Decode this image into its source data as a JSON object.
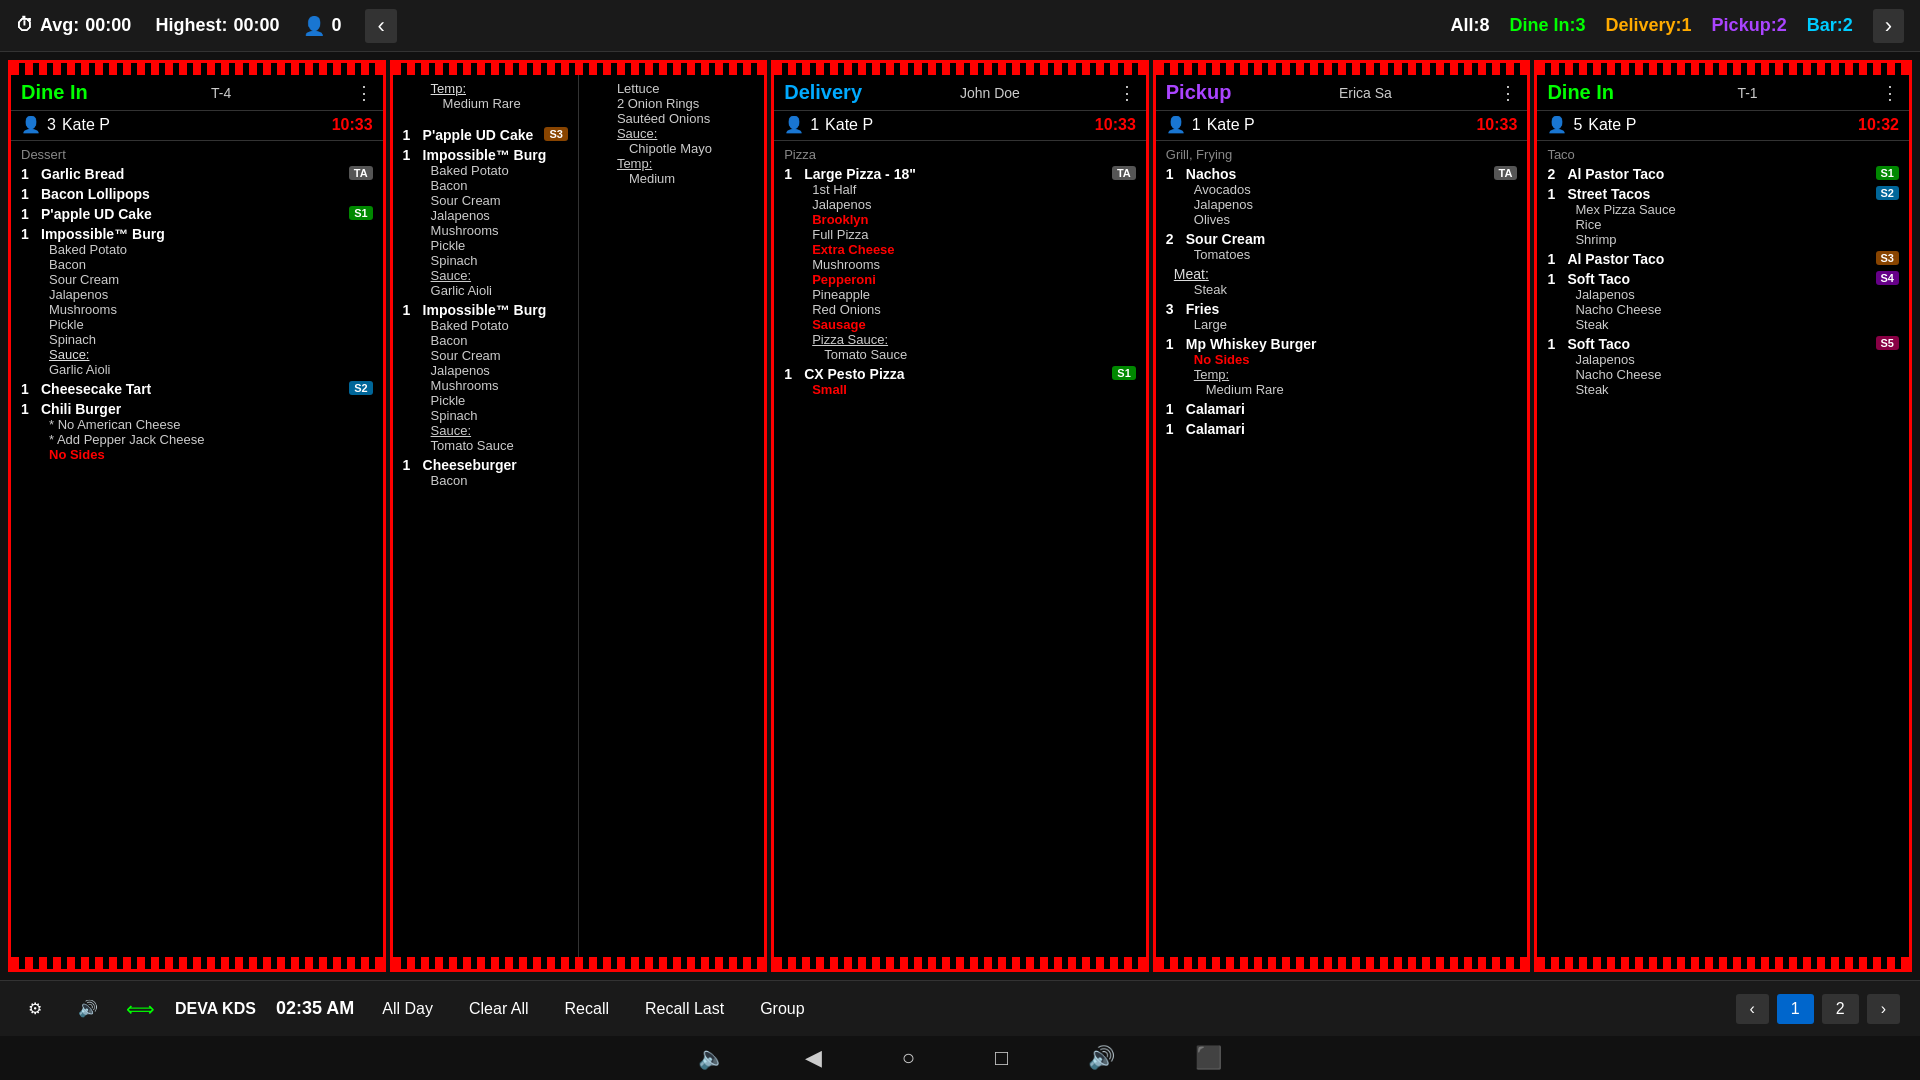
{
  "topBar": {
    "avg_label": "Avg:",
    "avg_value": "00:00",
    "highest_label": "Highest:",
    "highest_value": "00:00",
    "guests": "0",
    "counts": {
      "all_label": "All:",
      "all_value": "8",
      "dinein_label": "Dine In:",
      "dinein_value": "3",
      "delivery_label": "Delivery:",
      "delivery_value": "1",
      "pickup_label": "Pickup:",
      "pickup_value": "2",
      "bar_label": "Bar:",
      "bar_value": "2"
    }
  },
  "cards": [
    {
      "type": "Dine In",
      "typeClass": "dinein",
      "tableNum": "T-4",
      "customer": "Kate P",
      "guests": "3",
      "time": "10:33",
      "sectionLabel": "Dessert",
      "items": [
        {
          "qty": "1",
          "name": "Garlic Bread",
          "badge": "TA",
          "badgeClass": "ta",
          "modifiers": []
        },
        {
          "qty": "1",
          "name": "Bacon Lollipops",
          "badge": "",
          "badgeClass": "",
          "modifiers": []
        },
        {
          "qty": "1",
          "name": "P'apple UD Cake",
          "badge": "S1",
          "badgeClass": "s1",
          "modifiers": []
        },
        {
          "qty": "1",
          "name": "Impossible™ Burg",
          "badge": "",
          "badgeClass": "",
          "modifiers": [
            {
              "text": "Baked Potato",
              "style": ""
            },
            {
              "text": "Bacon",
              "style": ""
            },
            {
              "text": "Sour Cream",
              "style": ""
            },
            {
              "text": "Jalapenos",
              "style": ""
            },
            {
              "text": "Mushrooms",
              "style": ""
            },
            {
              "text": "Pickle",
              "style": ""
            },
            {
              "text": "Spinach",
              "style": ""
            },
            {
              "text": "Sauce:",
              "style": "underline"
            },
            {
              "text": "Garlic Aioli",
              "style": ""
            }
          ]
        },
        {
          "qty": "1",
          "name": "Cheesecake Tart",
          "badge": "S2",
          "badgeClass": "s2",
          "modifiers": []
        },
        {
          "qty": "1",
          "name": "Chili Burger",
          "badge": "",
          "badgeClass": "",
          "modifiers": [
            {
              "text": "* No American Cheese",
              "style": ""
            },
            {
              "text": "* Add Pepper Jack Cheese",
              "style": ""
            },
            {
              "text": "No Sides",
              "style": "red"
            }
          ]
        }
      ]
    },
    {
      "type": "continuation",
      "items_top": [
        {
          "text": "Temp:",
          "style": "underline"
        },
        {
          "text": "Medium Rare",
          "style": "indent"
        },
        {
          "text": "",
          "style": ""
        },
        {
          "qty": "1",
          "name": "P'apple UD Cake",
          "badge": "S3",
          "badgeClass": "s3"
        },
        {
          "qty": "1",
          "name": "Impossible™ Burg",
          "badge": "",
          "badgeClass": "",
          "modifiers": [
            "Baked Potato",
            "Bacon",
            "Sour Cream",
            "Jalapenos",
            "Mushrooms",
            "Pickle",
            "Spinach",
            "Sauce:",
            "Garlic Aioli"
          ]
        },
        {
          "qty": "1",
          "name": "Impossible™ Burg",
          "badge": "",
          "badgeClass": "",
          "modifiers": [
            "Baked Potato",
            "Bacon",
            "Sour Cream",
            "Jalapenos",
            "Mushrooms",
            "Pickle",
            "Spinach",
            "Sauce:",
            "Tomato Sauce"
          ]
        },
        {
          "qty": "1",
          "name": "Cheeseburger",
          "badge": "",
          "badgeClass": "",
          "modifiers": [
            "Bacon"
          ]
        }
      ],
      "items_right": [
        "Lettuce",
        "2 Onion Rings",
        "Sautéed Onions",
        "Sauce:",
        "Chipotle Mayo",
        "Temp:",
        "Medium"
      ]
    },
    {
      "type": "Delivery",
      "typeClass": "delivery",
      "customerName": "John Doe",
      "customer": "Kate P",
      "guests": "1",
      "time": "10:33",
      "sectionLabel": "Pizza",
      "items": [
        {
          "qty": "1",
          "name": "Large Pizza - 18\"",
          "badge": "TA",
          "badgeClass": "ta",
          "modifiers": [
            {
              "text": "1st Half",
              "style": ""
            },
            {
              "text": "Jalapenos",
              "style": ""
            },
            {
              "text": "Brooklyn",
              "style": "red"
            },
            {
              "text": "Full Pizza",
              "style": ""
            },
            {
              "text": "Extra Cheese",
              "style": "red"
            },
            {
              "text": "Mushrooms",
              "style": ""
            },
            {
              "text": "Pepperoni",
              "style": "red"
            },
            {
              "text": "Pineapple",
              "style": ""
            },
            {
              "text": "Red Onions",
              "style": ""
            },
            {
              "text": "Sausage",
              "style": "red"
            },
            {
              "text": "Pizza Sauce:",
              "style": "underline"
            },
            {
              "text": "Tomato Sauce",
              "style": ""
            }
          ]
        },
        {
          "qty": "1",
          "name": "CX Pesto Pizza",
          "badge": "S1",
          "badgeClass": "s1",
          "modifiers": [
            {
              "text": "Small",
              "style": "red"
            }
          ]
        }
      ]
    },
    {
      "type": "Pickup",
      "typeClass": "pickup",
      "customerName": "Erica Sa",
      "customer": "Kate P",
      "guests": "1",
      "time": "10:33",
      "sectionLabel": "Grill, Frying",
      "items": [
        {
          "qty": "1",
          "name": "Nachos",
          "badge": "TA",
          "badgeClass": "ta",
          "modifiers": [
            {
              "text": "Avocados",
              "style": ""
            },
            {
              "text": "Jalapenos",
              "style": ""
            },
            {
              "text": "Olives",
              "style": ""
            }
          ]
        },
        {
          "qty": "2",
          "name": "Sour Cream",
          "badge": "",
          "badgeClass": "",
          "modifiers": [
            {
              "text": "Tomatoes",
              "style": ""
            }
          ]
        },
        {
          "qty": "",
          "name": "Meat:",
          "badge": "",
          "badgeClass": "",
          "isLabel": true,
          "modifiers": [
            {
              "text": "Steak",
              "style": ""
            }
          ]
        },
        {
          "qty": "3",
          "name": "Fries",
          "badge": "",
          "badgeClass": "",
          "modifiers": [
            {
              "text": "Large",
              "style": ""
            }
          ]
        },
        {
          "qty": "1",
          "name": "Mp Whiskey Burger",
          "badge": "",
          "badgeClass": "",
          "modifiers": [
            {
              "text": "No Sides",
              "style": "red"
            },
            {
              "text": "Temp:",
              "style": "underline"
            },
            {
              "text": "Medium Rare",
              "style": ""
            }
          ]
        },
        {
          "qty": "1",
          "name": "Calamari",
          "badge": "",
          "badgeClass": "",
          "modifiers": []
        },
        {
          "qty": "1",
          "name": "Calamari",
          "badge": "",
          "badgeClass": "",
          "modifiers": []
        }
      ]
    },
    {
      "type": "Dine In",
      "typeClass": "dinein",
      "tableNum": "T-1",
      "customer": "Kate P",
      "guests": "5",
      "time": "10:32",
      "sectionLabel": "Taco",
      "items": [
        {
          "qty": "2",
          "name": "Al Pastor Taco",
          "badge": "S1",
          "badgeClass": "s1",
          "modifiers": []
        },
        {
          "qty": "1",
          "name": "Street Tacos",
          "badge": "S2",
          "badgeClass": "s2",
          "modifiers": [
            {
              "text": "Mex Pizza Sauce",
              "style": ""
            },
            {
              "text": "Rice",
              "style": ""
            },
            {
              "text": "Shrimp",
              "style": ""
            }
          ]
        },
        {
          "qty": "1",
          "name": "Al Pastor Taco",
          "badge": "S3",
          "badgeClass": "s3",
          "modifiers": []
        },
        {
          "qty": "1",
          "name": "Soft Taco",
          "badge": "S4",
          "badgeClass": "s4",
          "modifiers": [
            {
              "text": "Jalapenos",
              "style": ""
            },
            {
              "text": "Nacho Cheese",
              "style": ""
            },
            {
              "text": "Steak",
              "style": ""
            }
          ]
        },
        {
          "qty": "1",
          "name": "Soft Taco",
          "badge": "S5",
          "badgeClass": "s5",
          "modifiers": [
            {
              "text": "Jalapenos",
              "style": ""
            },
            {
              "text": "Nacho Cheese",
              "style": ""
            },
            {
              "text": "Steak",
              "style": ""
            }
          ]
        }
      ]
    }
  ],
  "bottomBar": {
    "settings_icon": "⚙",
    "sound_icon": "🔊",
    "sync_icon": "⟺",
    "station_name": "DEVA KDS",
    "time": "02:35 AM",
    "buttons": [
      "All Day",
      "Clear All",
      "Recall",
      "Recall Last",
      "Group"
    ],
    "page1": "1",
    "page2": "2"
  },
  "androidNav": {
    "vol_down": "🔈",
    "back": "◀",
    "home": "○",
    "square": "□",
    "vol_up": "🔊",
    "screenshot": "⬛"
  }
}
